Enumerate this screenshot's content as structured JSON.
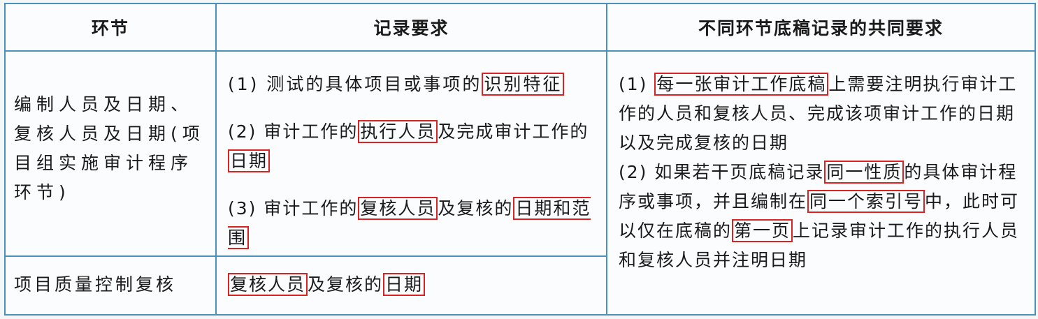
{
  "table": {
    "headers": [
      "环节",
      "记录要求",
      "不同环节底稿记录的共同要求"
    ],
    "rows": [
      {
        "stage": "编制人员及日期、复核人员及日期(项目组实施审计程序环节)",
        "requirements": [
          {
            "text": "(1) 测试的具体项目或事项的",
            "highlight": "识别特征",
            "after": ""
          },
          {
            "text": "(2) 审计工作的",
            "highlight": "执行人员",
            "after": "及完成审计工作的",
            "highlight2": "日期"
          },
          {
            "text": "(3) 审计工作的",
            "highlight": "复核人员",
            "after": "及复核的",
            "highlight2": "日期和范围"
          }
        ]
      },
      {
        "stage": "项目质量控制复核",
        "requirements": [
          {
            "highlight": "复核人员",
            "after": "及复核的",
            "highlight2": "日期"
          }
        ]
      }
    ],
    "common": {
      "item1_prefix": "(1)",
      "item1_highlight": "每一张审计工作底稿",
      "item1_rest": "上需要注明执行审计工作的人员和复核人员、完成该项审计工作的日期以及完成复核的日期",
      "item2_prefix": "(2) 如果若干页底稿记录",
      "item2_highlight1": "同一性质",
      "item2_mid1": "的具体审计程序或事项，并且编制在",
      "item2_highlight2": "同一个索引号",
      "item2_mid2": "中，此时可以仅在底稿的",
      "item2_highlight3": "第一页",
      "item2_rest": "上记录审计工作的执行人员和复核人员并注明日期"
    }
  },
  "colors": {
    "border": "#4a90b8",
    "highlight": "#d92323"
  }
}
